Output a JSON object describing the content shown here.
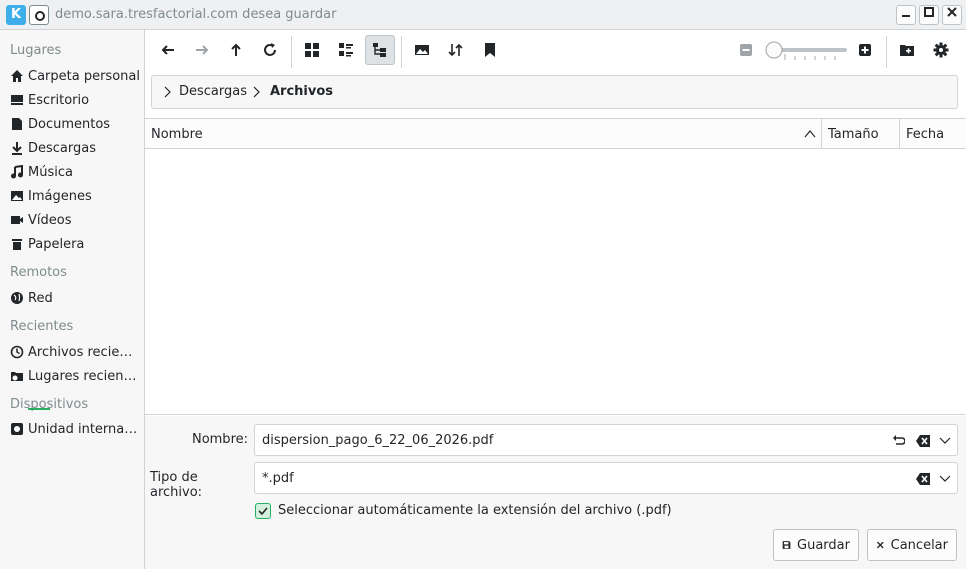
{
  "window": {
    "title": "demo.sara.tresfactorial.com desea guardar",
    "app_icon_glyph": "K"
  },
  "sidebar": {
    "sections": [
      {
        "title": "Lugares",
        "items": [
          {
            "label": "Carpeta personal",
            "icon": "home-icon"
          },
          {
            "label": "Escritorio",
            "icon": "desktop-icon"
          },
          {
            "label": "Documentos",
            "icon": "document-icon"
          },
          {
            "label": "Descargas",
            "icon": "download-icon"
          },
          {
            "label": "Música",
            "icon": "music-icon"
          },
          {
            "label": "Imágenes",
            "icon": "image-icon"
          },
          {
            "label": "Vídeos",
            "icon": "video-icon"
          },
          {
            "label": "Papelera",
            "icon": "trash-icon"
          }
        ]
      },
      {
        "title": "Remotos",
        "items": [
          {
            "label": "Red",
            "icon": "network-icon"
          }
        ]
      },
      {
        "title": "Recientes",
        "items": [
          {
            "label": "Archivos recientes",
            "icon": "clock-icon"
          },
          {
            "label": "Lugares recientes",
            "icon": "recent-folder-icon"
          }
        ]
      },
      {
        "title": "Dispositivos",
        "items": [
          {
            "label": "Unidad interna ...",
            "icon": "drive-icon"
          }
        ]
      }
    ]
  },
  "breadcrumb": {
    "items": [
      "Descargas",
      "Archivos"
    ]
  },
  "file_list": {
    "columns": [
      "Nombre",
      "Tamaño",
      "Fecha"
    ],
    "sort_column": "Nombre",
    "sort_order": "ascending",
    "rows": []
  },
  "form": {
    "name_label": "Nombre:",
    "name_value": "dispersion_pago_6_22_06_2026.pdf",
    "filetype_label": "Tipo de archivo:",
    "filetype_value": "*.pdf",
    "auto_extension_label": "Seleccionar automáticamente la extensión del archivo (.pdf)",
    "auto_extension_checked": true
  },
  "buttons": {
    "save": "Guardar",
    "cancel": "Cancelar"
  },
  "colors": {
    "accent": "#3daee9",
    "check": "#27ae60",
    "text": "#232629",
    "muted": "#7f8c8d"
  }
}
